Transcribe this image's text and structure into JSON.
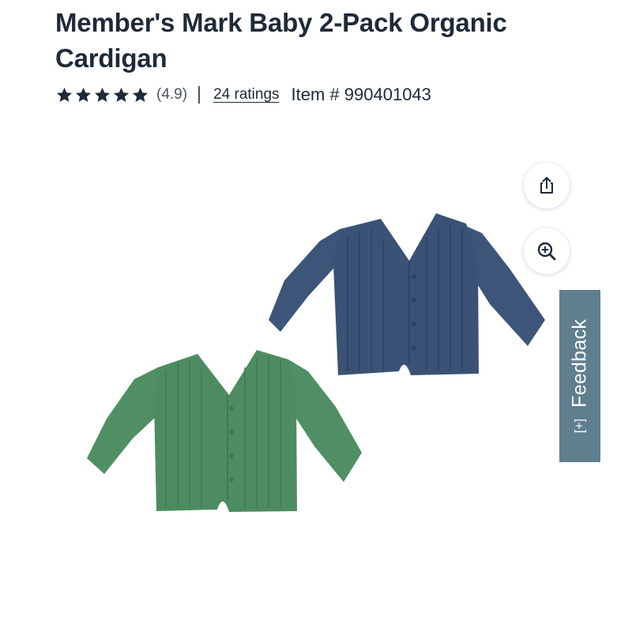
{
  "product": {
    "title": "Member's Mark Baby 2-Pack Organic Cardigan",
    "rating_value": "(4.9)",
    "rating_stars": 5,
    "ratings_count_label": "24 ratings",
    "item_number_label": "Item # 990401043"
  },
  "actions": {
    "share_icon": "share-icon",
    "zoom_icon": "zoom-in-icon"
  },
  "feedback": {
    "label": "Feedback",
    "icon_glyph": "[+]"
  },
  "colors": {
    "title": "#1f2a38",
    "feedback_tab": "#5f7f8e",
    "cardigan_navy": "#3a5275",
    "cardigan_green": "#4f8f63"
  }
}
